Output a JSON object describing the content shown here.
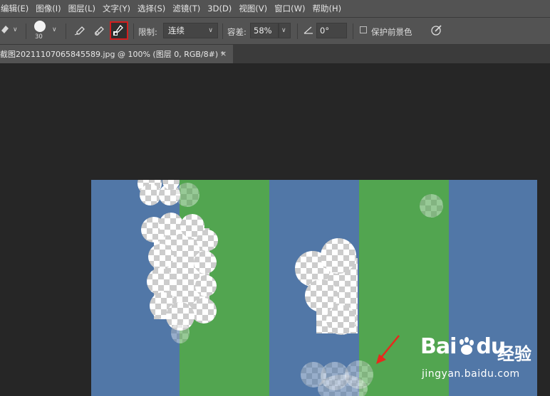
{
  "menubar": {
    "items": [
      "编辑(E)",
      "图像(I)",
      "图层(L)",
      "文字(Y)",
      "选择(S)",
      "滤镜(T)",
      "3D(D)",
      "视图(V)",
      "窗口(W)",
      "帮助(H)"
    ]
  },
  "options": {
    "brush_size": "30",
    "limit_label": "限制:",
    "limit_value": "连续",
    "tolerance_label": "容差:",
    "tolerance_value": "58%",
    "angle_value": "0°",
    "protect_label": "保护前景色",
    "protect_checked": false
  },
  "document_tab": {
    "title": "截图20211107065845589.jpg @ 100% (图层 0, RGB/8#) *",
    "close": "×"
  },
  "canvas": {
    "stripe_colors": [
      "#5177a7",
      "#52a550",
      "#5177a7",
      "#52a550",
      "#5177a7"
    ]
  },
  "colors": {
    "accent_red": "#d11f1f",
    "arrow_red": "#e8291c"
  },
  "watermark": {
    "brand": "Bai",
    "brand_suffix": "du",
    "product": "经验",
    "url": "jingyan.baidu.com"
  }
}
